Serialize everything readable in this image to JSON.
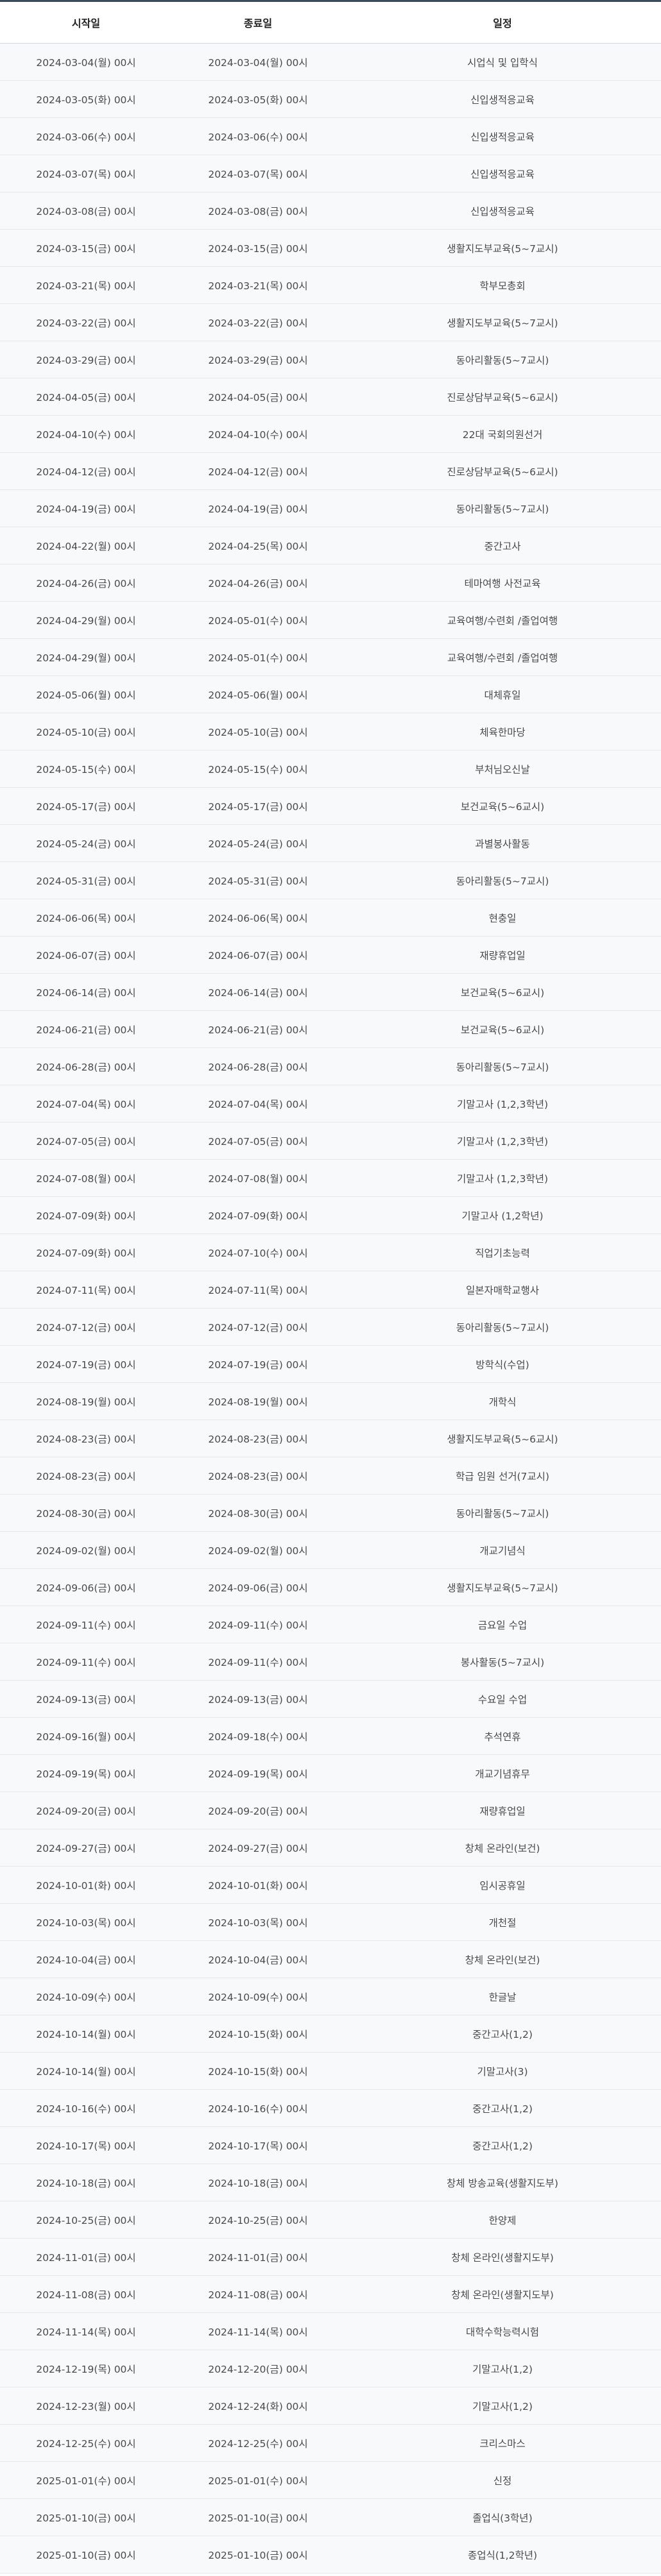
{
  "headers": [
    "시작일",
    "종료일",
    "일정"
  ],
  "rows": [
    [
      "2024-03-04(월) 00시",
      "2024-03-04(월) 00시",
      "시업식 및 입학식"
    ],
    [
      "2024-03-05(화) 00시",
      "2024-03-05(화) 00시",
      "신입생적응교육"
    ],
    [
      "2024-03-06(수) 00시",
      "2024-03-06(수) 00시",
      "신입생적응교육"
    ],
    [
      "2024-03-07(목) 00시",
      "2024-03-07(목) 00시",
      "신입생적응교육"
    ],
    [
      "2024-03-08(금) 00시",
      "2024-03-08(금) 00시",
      "신입생적응교육"
    ],
    [
      "2024-03-15(금) 00시",
      "2024-03-15(금) 00시",
      "생활지도부교육(5~7교시)"
    ],
    [
      "2024-03-21(목) 00시",
      "2024-03-21(목) 00시",
      "학부모총회"
    ],
    [
      "2024-03-22(금) 00시",
      "2024-03-22(금) 00시",
      "생활지도부교육(5~7교시)"
    ],
    [
      "2024-03-29(금) 00시",
      "2024-03-29(금) 00시",
      "동아리활동(5~7교시)"
    ],
    [
      "2024-04-05(금) 00시",
      "2024-04-05(금) 00시",
      "진로상담부교육(5~6교시)"
    ],
    [
      "2024-04-10(수) 00시",
      "2024-04-10(수) 00시",
      "22대 국회의원선거"
    ],
    [
      "2024-04-12(금) 00시",
      "2024-04-12(금) 00시",
      "진로상담부교육(5~6교시)"
    ],
    [
      "2024-04-19(금) 00시",
      "2024-04-19(금) 00시",
      "동아리활동(5~7교시)"
    ],
    [
      "2024-04-22(월) 00시",
      "2024-04-25(목) 00시",
      "중간고사"
    ],
    [
      "2024-04-26(금) 00시",
      "2024-04-26(금) 00시",
      "테마여행 사전교육"
    ],
    [
      "2024-04-29(월) 00시",
      "2024-05-01(수) 00시",
      "교육여행/수련회 /졸업여행"
    ],
    [
      "2024-04-29(월) 00시",
      "2024-05-01(수) 00시",
      "교육여행/수련회 /졸업여행"
    ],
    [
      "2024-05-06(월) 00시",
      "2024-05-06(월) 00시",
      "대체휴일"
    ],
    [
      "2024-05-10(금) 00시",
      "2024-05-10(금) 00시",
      "체육한마당"
    ],
    [
      "2024-05-15(수) 00시",
      "2024-05-15(수) 00시",
      "부처님오신날"
    ],
    [
      "2024-05-17(금) 00시",
      "2024-05-17(금) 00시",
      "보건교육(5~6교시)"
    ],
    [
      "2024-05-24(금) 00시",
      "2024-05-24(금) 00시",
      "과별봉사활동"
    ],
    [
      "2024-05-31(금) 00시",
      "2024-05-31(금) 00시",
      "동아리활동(5~7교시)"
    ],
    [
      "2024-06-06(목) 00시",
      "2024-06-06(목) 00시",
      "현충일"
    ],
    [
      "2024-06-07(금) 00시",
      "2024-06-07(금) 00시",
      "재량휴업일"
    ],
    [
      "2024-06-14(금) 00시",
      "2024-06-14(금) 00시",
      "보건교육(5~6교시)"
    ],
    [
      "2024-06-21(금) 00시",
      "2024-06-21(금) 00시",
      "보건교육(5~6교시)"
    ],
    [
      "2024-06-28(금) 00시",
      "2024-06-28(금) 00시",
      "동아리활동(5~7교시)"
    ],
    [
      "2024-07-04(목) 00시",
      "2024-07-04(목) 00시",
      "기말고사 (1,2,3학년)"
    ],
    [
      "2024-07-05(금) 00시",
      "2024-07-05(금) 00시",
      "기말고사 (1,2,3학년)"
    ],
    [
      "2024-07-08(월) 00시",
      "2024-07-08(월) 00시",
      "기말고사 (1,2,3학년)"
    ],
    [
      "2024-07-09(화) 00시",
      "2024-07-09(화) 00시",
      "기말고사 (1,2학년)"
    ],
    [
      "2024-07-09(화) 00시",
      "2024-07-10(수) 00시",
      "직업기초능력"
    ],
    [
      "2024-07-11(목) 00시",
      "2024-07-11(목) 00시",
      "일본자매학교행사"
    ],
    [
      "2024-07-12(금) 00시",
      "2024-07-12(금) 00시",
      "동아리활동(5~7교시)"
    ],
    [
      "2024-07-19(금) 00시",
      "2024-07-19(금) 00시",
      "방학식(수업)"
    ],
    [
      "2024-08-19(월) 00시",
      "2024-08-19(월) 00시",
      "개학식"
    ],
    [
      "2024-08-23(금) 00시",
      "2024-08-23(금) 00시",
      "생활지도부교육(5~6교시)"
    ],
    [
      "2024-08-23(금) 00시",
      "2024-08-23(금) 00시",
      "학급 임원 선거(7교시)"
    ],
    [
      "2024-08-30(금) 00시",
      "2024-08-30(금) 00시",
      "동아리활동(5~7교시)"
    ],
    [
      "2024-09-02(월) 00시",
      "2024-09-02(월) 00시",
      "개교기념식"
    ],
    [
      "2024-09-06(금) 00시",
      "2024-09-06(금) 00시",
      "생활지도부교육(5~7교시)"
    ],
    [
      "2024-09-11(수) 00시",
      "2024-09-11(수) 00시",
      "금요일 수업"
    ],
    [
      "2024-09-11(수) 00시",
      "2024-09-11(수) 00시",
      "봉사활동(5~7교시)"
    ],
    [
      "2024-09-13(금) 00시",
      "2024-09-13(금) 00시",
      "수요일 수업"
    ],
    [
      "2024-09-16(월) 00시",
      "2024-09-18(수) 00시",
      "추석연휴"
    ],
    [
      "2024-09-19(목) 00시",
      "2024-09-19(목) 00시",
      "개교기념휴무"
    ],
    [
      "2024-09-20(금) 00시",
      "2024-09-20(금) 00시",
      "재량휴업일"
    ],
    [
      "2024-09-27(금) 00시",
      "2024-09-27(금) 00시",
      "창체 온라인(보건)"
    ],
    [
      "2024-10-01(화) 00시",
      "2024-10-01(화) 00시",
      "임시공휴일"
    ],
    [
      "2024-10-03(목) 00시",
      "2024-10-03(목) 00시",
      "개천절"
    ],
    [
      "2024-10-04(금) 00시",
      "2024-10-04(금) 00시",
      "창체 온라인(보건)"
    ],
    [
      "2024-10-09(수) 00시",
      "2024-10-09(수) 00시",
      "한글날"
    ],
    [
      "2024-10-14(월) 00시",
      "2024-10-15(화) 00시",
      "중간고사(1,2)"
    ],
    [
      "2024-10-14(월) 00시",
      "2024-10-15(화) 00시",
      "기말고사(3)"
    ],
    [
      "2024-10-16(수) 00시",
      "2024-10-16(수) 00시",
      "중간고사(1,2)"
    ],
    [
      "2024-10-17(목) 00시",
      "2024-10-17(목) 00시",
      "중간고사(1,2)"
    ],
    [
      "2024-10-18(금) 00시",
      "2024-10-18(금) 00시",
      "창체 방송교육(생활지도부)"
    ],
    [
      "2024-10-25(금) 00시",
      "2024-10-25(금) 00시",
      "한양제"
    ],
    [
      "2024-11-01(금) 00시",
      "2024-11-01(금) 00시",
      "창체 온라인(생활지도부)"
    ],
    [
      "2024-11-08(금) 00시",
      "2024-11-08(금) 00시",
      "창체 온라인(생활지도부)"
    ],
    [
      "2024-11-14(목) 00시",
      "2024-11-14(목) 00시",
      "대학수학능력시험"
    ],
    [
      "2024-12-19(목) 00시",
      "2024-12-20(금) 00시",
      "기말고사(1,2)"
    ],
    [
      "2024-12-23(월) 00시",
      "2024-12-24(화) 00시",
      "기말고사(1,2)"
    ],
    [
      "2024-12-25(수) 00시",
      "2024-12-25(수) 00시",
      "크리스마스"
    ],
    [
      "2025-01-01(수) 00시",
      "2025-01-01(수) 00시",
      "신정"
    ],
    [
      "2025-01-10(금) 00시",
      "2025-01-10(금) 00시",
      "졸업식(3학년)"
    ],
    [
      "2025-01-10(금) 00시",
      "2025-01-10(금) 00시",
      "종업식(1,2학년)"
    ]
  ]
}
